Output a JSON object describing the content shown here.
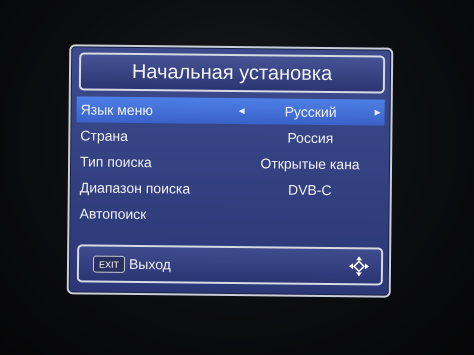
{
  "dialog": {
    "title": "Начальная установка"
  },
  "menu": {
    "items": [
      {
        "label": "Язык меню",
        "value": "Русский",
        "selected": true
      },
      {
        "label": "Страна",
        "value": "Россия",
        "selected": false
      },
      {
        "label": "Тип поиска",
        "value": "Открытые кана",
        "selected": false
      },
      {
        "label": "Диапазон поиска",
        "value": "DVB-C",
        "selected": false
      },
      {
        "label": "Автопоиск",
        "value": "",
        "selected": false
      }
    ],
    "arrow_left": "◄",
    "arrow_right": "►"
  },
  "footer": {
    "exit_key": "EXIT",
    "exit_label": "Выход",
    "nav_icon": "four-way-navigation-icon"
  },
  "colors": {
    "panel": "#2f3b7c",
    "selection": "#4570db",
    "border": "#d6dae3"
  }
}
